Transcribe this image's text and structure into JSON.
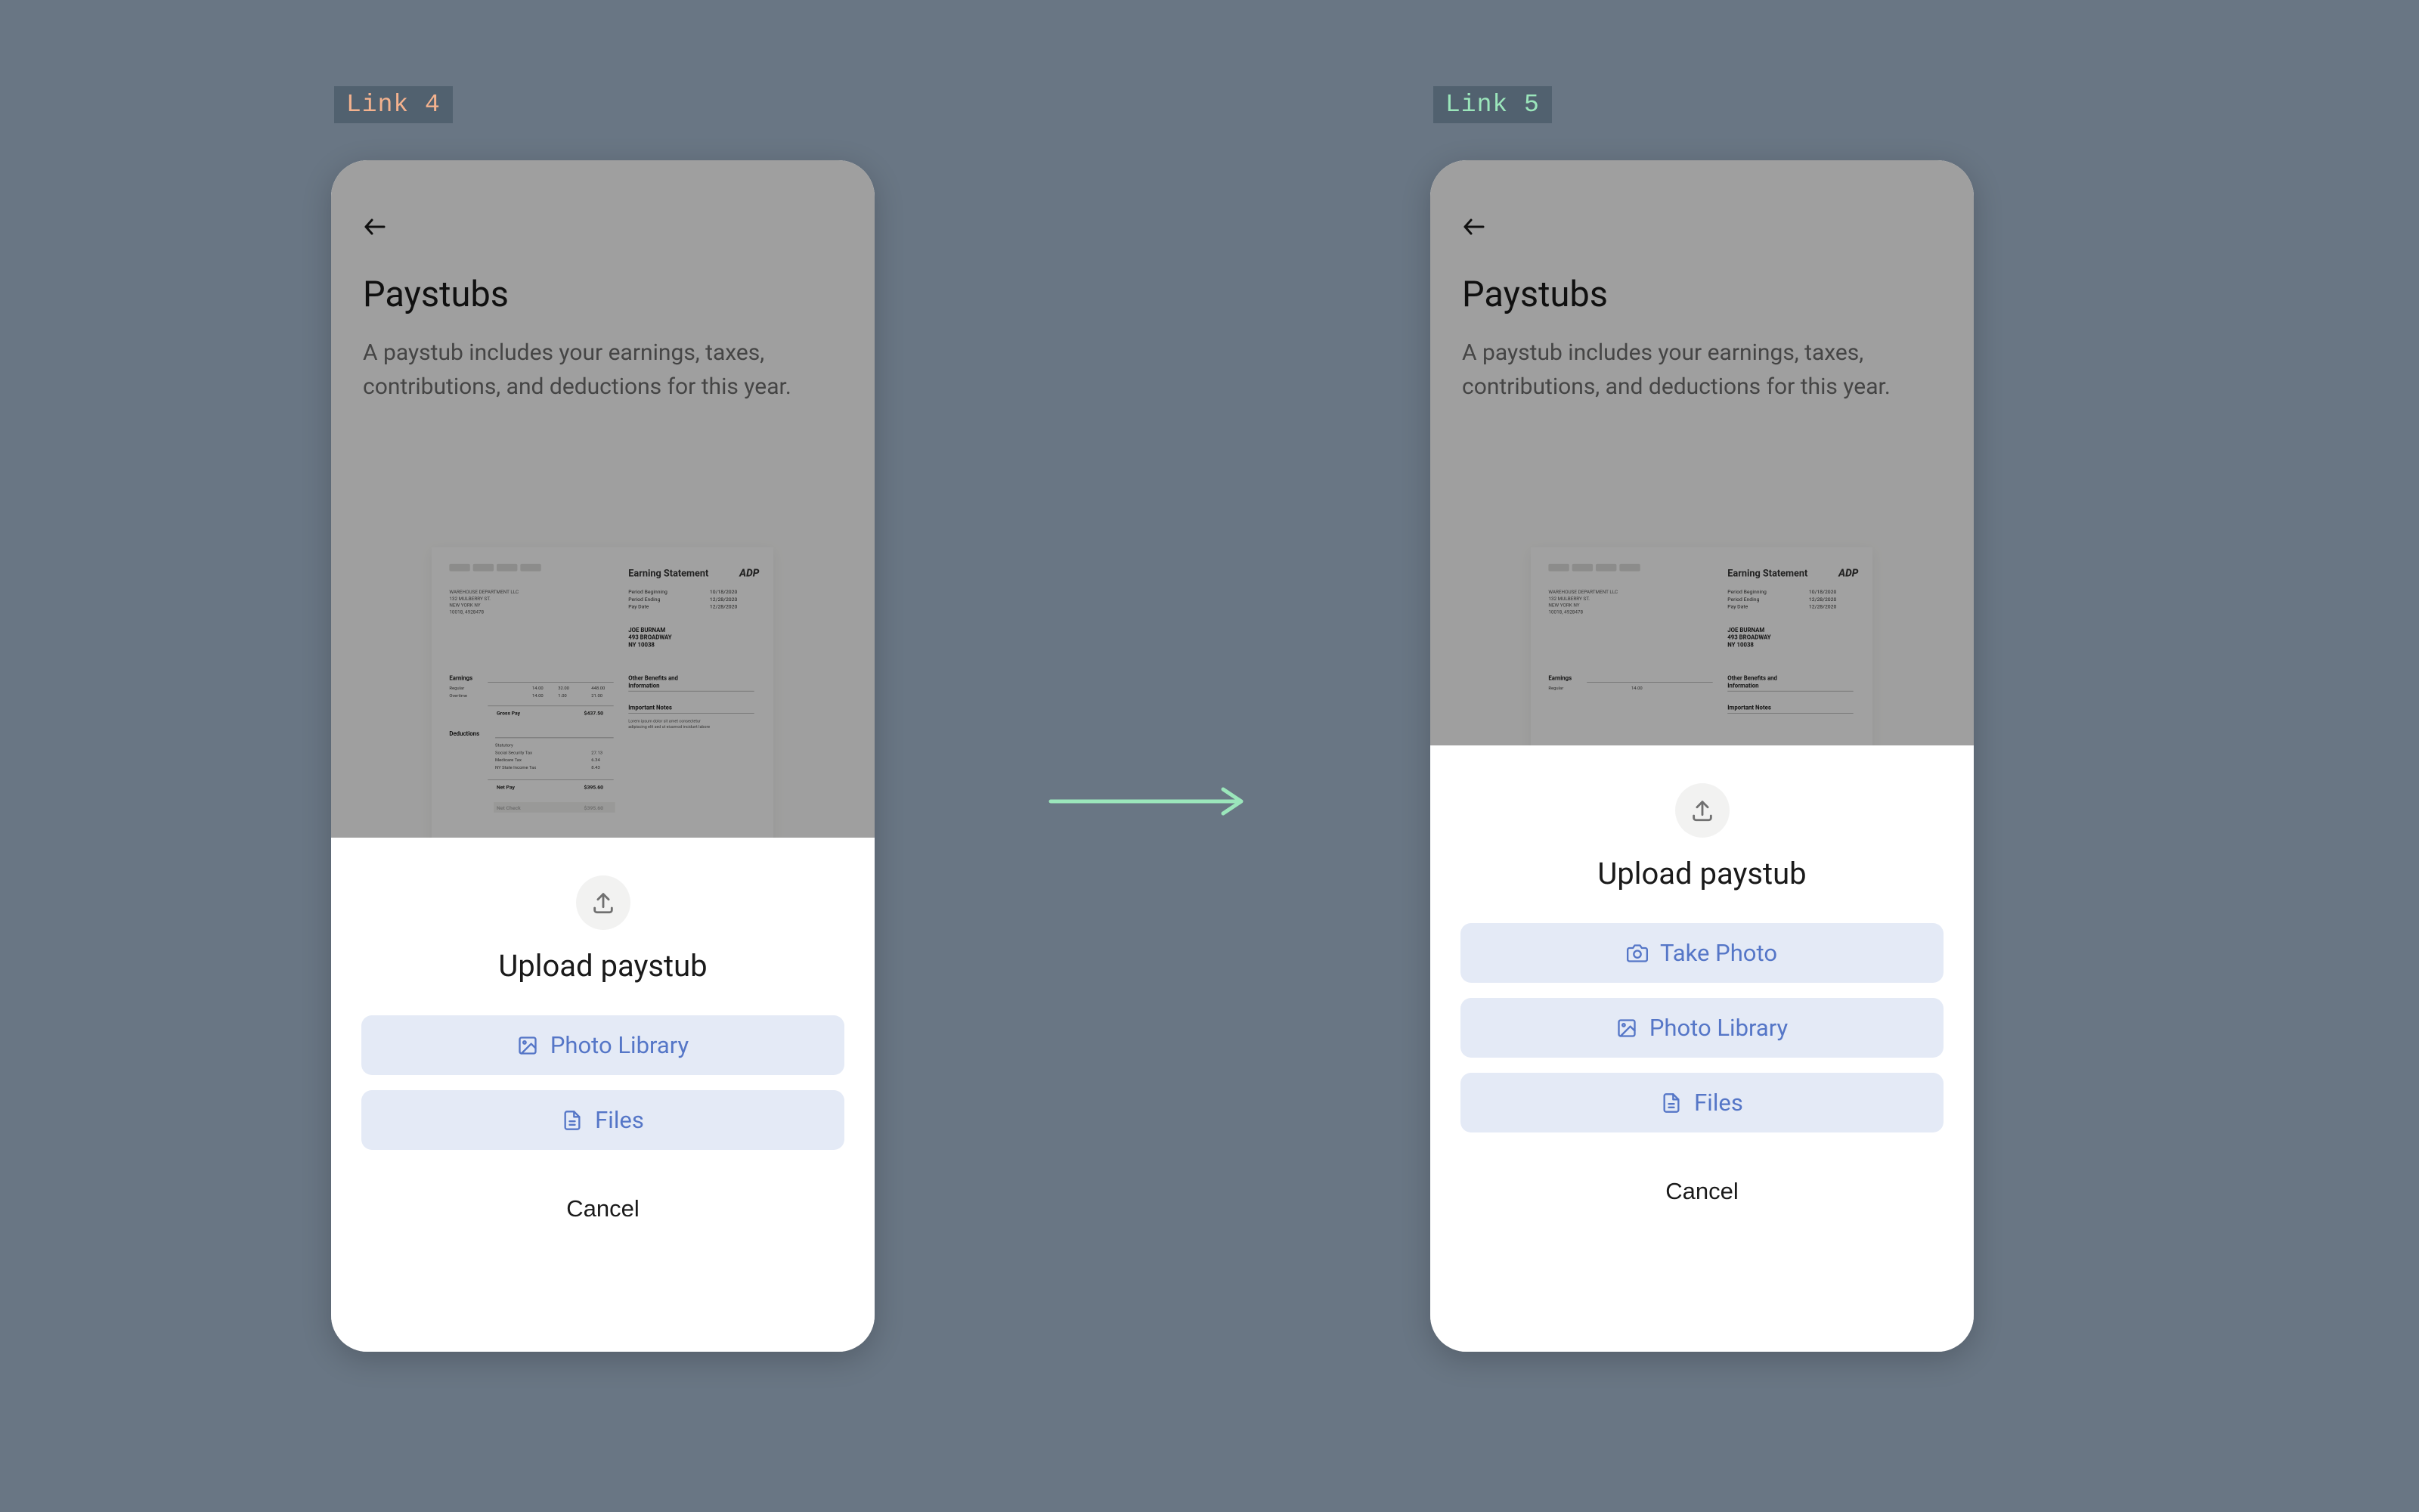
{
  "labelLeft": "Link 4",
  "labelRight": "Link 5",
  "page": {
    "heading": "Paystubs",
    "description": "A paystub includes your earnings, taxes, contributions, and deductions for this year."
  },
  "docPreview": {
    "title": "Earning Statement",
    "brand": "ADP",
    "meta": {
      "periodBeginningLabel": "Period Beginning",
      "periodEndingLabel": "Period Ending",
      "payDateLabel": "Pay Date"
    },
    "payee": {
      "name": "JOE BURNAM",
      "addr1": "493 BROADWAY",
      "addr2": "NY 10038"
    },
    "sections": {
      "earnings": "Earnings",
      "deductions": "Deductions",
      "grossPay": "Gross Pay",
      "netCheck": "Net Check",
      "netPay": "Net Pay",
      "otherBenefits": "Other Benefits and Information",
      "importantNotes": "Important Notes"
    }
  },
  "sheet": {
    "title": "Upload paystub",
    "options": {
      "takePhoto": "Take Photo",
      "photoLibrary": "Photo Library",
      "files": "Files"
    },
    "cancel": "Cancel"
  }
}
